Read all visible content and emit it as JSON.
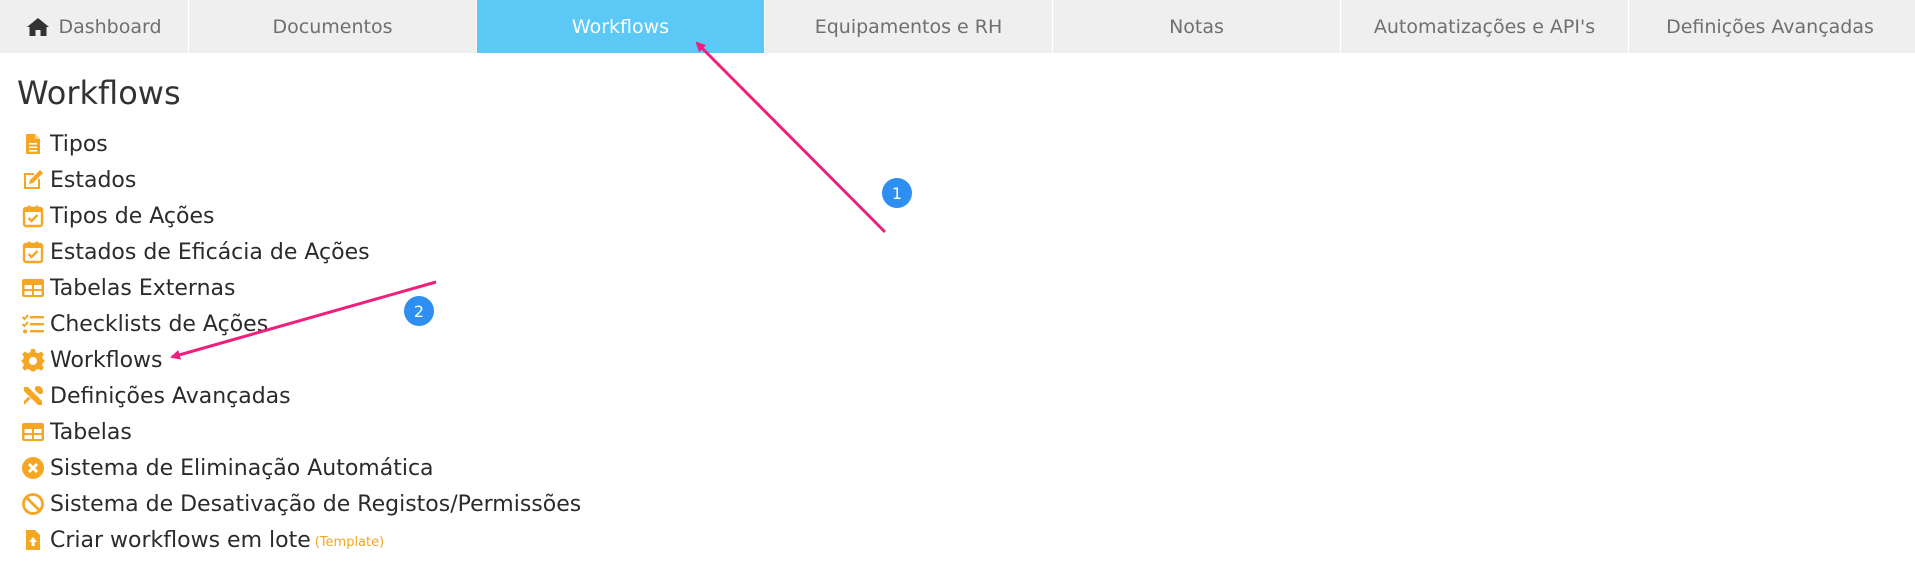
{
  "tabs": [
    {
      "label": "Dashboard",
      "icon": "home-icon",
      "active": false
    },
    {
      "label": "Documentos",
      "active": false
    },
    {
      "label": "Workflows",
      "active": true
    },
    {
      "label": "Equipamentos e RH",
      "active": false
    },
    {
      "label": "Notas",
      "active": false
    },
    {
      "label": "Automatizações e API's",
      "active": false
    },
    {
      "label": "Definições Avançadas",
      "active": false
    }
  ],
  "page_title": "Workflows",
  "menu": [
    {
      "label": "Tipos",
      "icon": "file-icon"
    },
    {
      "label": "Estados",
      "icon": "edit-icon"
    },
    {
      "label": "Tipos de Ações",
      "icon": "calendar-check-icon"
    },
    {
      "label": "Estados de Eficácia de Ações",
      "icon": "calendar-check-icon"
    },
    {
      "label": "Tabelas Externas",
      "icon": "table-icon"
    },
    {
      "label": "Checklists de Ações",
      "icon": "checklist-icon"
    },
    {
      "label": "Workflows",
      "icon": "gear-icon"
    },
    {
      "label": "Definições Avançadas",
      "icon": "tools-icon"
    },
    {
      "label": "Tabelas",
      "icon": "table-icon"
    },
    {
      "label": "Sistema de Eliminação Automática",
      "icon": "x-circle-icon"
    },
    {
      "label": "Sistema de Desativação de Registos/Permissões",
      "icon": "ban-icon"
    },
    {
      "label": "Criar workflows em lote",
      "icon": "file-upload-icon",
      "note": "(Template)"
    }
  ],
  "annotations": {
    "badge_1": "1",
    "badge_2": "2"
  },
  "colors": {
    "tab_active": "#5bc8f5",
    "tab_bg": "#efefef",
    "icon_orange": "#f5a623",
    "arrow_pink": "#ef1f7b",
    "badge_blue": "#2e8ff0"
  }
}
